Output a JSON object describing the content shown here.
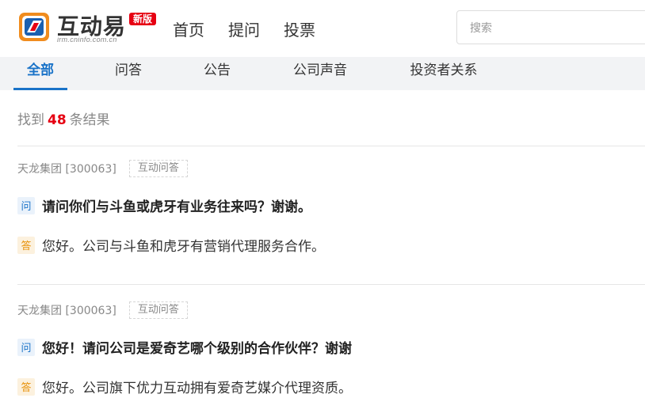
{
  "header": {
    "logo_text": "互动易",
    "logo_sub": "irm.cninfo.com.cn",
    "badge": "新版",
    "nav": [
      "首页",
      "提问",
      "投票"
    ],
    "search_placeholder": "搜索"
  },
  "tabs": [
    "全部",
    "问答",
    "公告",
    "公司声音",
    "投资者关系"
  ],
  "active_tab": "全部",
  "results": {
    "prefix": "找到",
    "count": "48",
    "suffix": "条结果"
  },
  "items": [
    {
      "company": "天龙集团 [300063]",
      "tag": "互动问答",
      "q_mark": "问",
      "question": "请问你们与斗鱼或虎牙有业务往来吗？谢谢。",
      "a_mark": "答",
      "answer": "您好。公司与斗鱼和虎牙有营销代理服务合作。"
    },
    {
      "company": "天龙集团 [300063]",
      "tag": "互动问答",
      "q_mark": "问",
      "question": "您好！请问公司是爱奇艺哪个级别的合作伙伴？谢谢",
      "a_mark": "答",
      "answer": "您好。公司旗下优力互动拥有爱奇艺媒介代理资质。"
    }
  ],
  "colors": {
    "accent": "#1a73c8",
    "brand_red": "#e60012",
    "answer_mark": "#e8930d"
  }
}
